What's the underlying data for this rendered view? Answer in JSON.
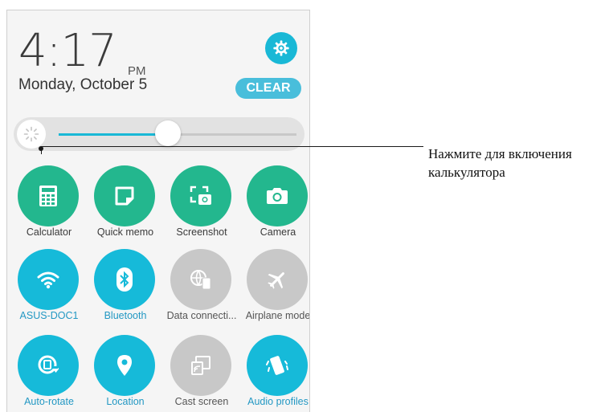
{
  "clock": {
    "time": "4:17",
    "ampm": "PM",
    "date": "Monday, October 5"
  },
  "header": {
    "clear_label": "CLEAR",
    "settings_icon": "gear-icon"
  },
  "brightness": {
    "level": 0.46,
    "icon": "brightness-icon"
  },
  "tiles": [
    {
      "label": "Calculator",
      "icon": "calculator-icon",
      "color": "#23b78e"
    },
    {
      "label": "Quick memo",
      "icon": "memo-icon",
      "color": "#23b78e"
    },
    {
      "label": "Screenshot",
      "icon": "screenshot-icon",
      "color": "#23b78e"
    },
    {
      "label": "Camera",
      "icon": "camera-icon",
      "color": "#23b78e"
    },
    {
      "label": "ASUS-DOC1",
      "icon": "wifi-icon",
      "color": "#16bad9"
    },
    {
      "label": "Bluetooth",
      "icon": "bluetooth-icon",
      "color": "#16bad9"
    },
    {
      "label": "Data connecti...",
      "icon": "data-connection-icon",
      "color": "#c8c8c8"
    },
    {
      "label": "Airplane mode",
      "icon": "airplane-icon",
      "color": "#c8c8c8"
    },
    {
      "label": "Auto-rotate",
      "icon": "auto-rotate-icon",
      "color": "#16bad9"
    },
    {
      "label": "Location",
      "icon": "location-icon",
      "color": "#16bad9"
    },
    {
      "label": "Cast screen",
      "icon": "cast-screen-icon",
      "color": "#c8c8c8"
    },
    {
      "label": "Audio profiles",
      "icon": "audio-profiles-icon",
      "color": "#16bad9"
    }
  ],
  "callout": {
    "line1": "Нажмите для включения",
    "line2": "калькулятора"
  }
}
